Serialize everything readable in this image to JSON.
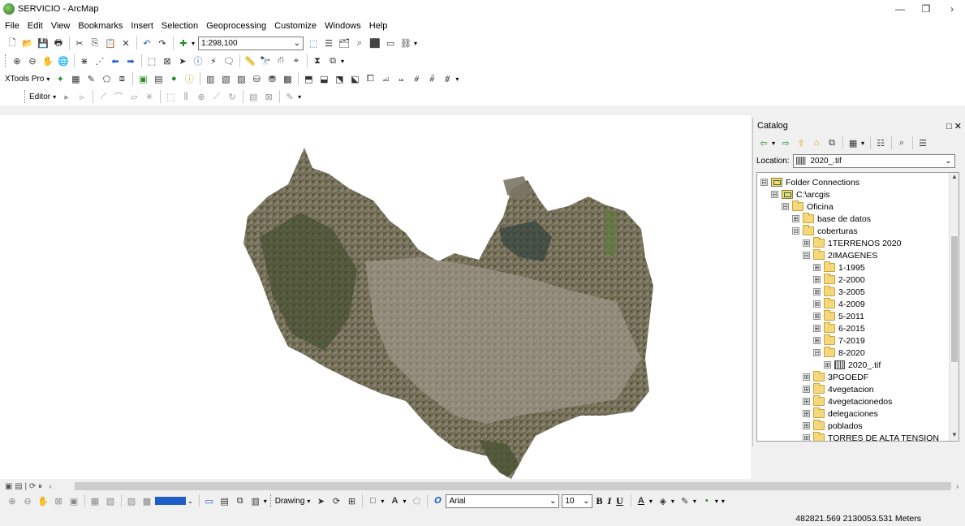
{
  "window": {
    "title": "SERVICIO - ArcMap",
    "controls": [
      "—",
      "❐",
      "›"
    ]
  },
  "menu": [
    "File",
    "Edit",
    "View",
    "Bookmarks",
    "Insert",
    "Selection",
    "Geoprocessing",
    "Customize",
    "Windows",
    "Help"
  ],
  "toolbar_standard": {
    "scale": "1:298,100"
  },
  "toolbar_xtools": {
    "label": "XTools Pro"
  },
  "toolbar_editor": {
    "label": "Editor"
  },
  "catalog": {
    "title": "Catalog",
    "location_label": "Location:",
    "location_value": "2020_.tif",
    "tree": [
      {
        "label": "Folder Connections",
        "depth": 0,
        "expander": "⊟",
        "icon": "folder-connections-icon"
      },
      {
        "label": "C:\\arcgis",
        "depth": 1,
        "expander": "⊟",
        "icon": "folder-connection-icon"
      },
      {
        "label": "Oficina",
        "depth": 2,
        "expander": "⊟",
        "icon": "folder-icon"
      },
      {
        "label": "base de datos",
        "depth": 3,
        "expander": "⊞",
        "icon": "folder-icon"
      },
      {
        "label": "coberturas",
        "depth": 3,
        "expander": "⊟",
        "icon": "folder-icon"
      },
      {
        "label": "1TERRENOS 2020",
        "depth": 4,
        "expander": "⊞",
        "icon": "folder-icon"
      },
      {
        "label": "2IMAGENES",
        "depth": 4,
        "expander": "⊟",
        "icon": "folder-icon"
      },
      {
        "label": "1-1995",
        "depth": 5,
        "expander": "⊞",
        "icon": "folder-icon"
      },
      {
        "label": "2-2000",
        "depth": 5,
        "expander": "⊞",
        "icon": "folder-icon"
      },
      {
        "label": "3-2005",
        "depth": 5,
        "expander": "⊞",
        "icon": "folder-icon"
      },
      {
        "label": "4-2009",
        "depth": 5,
        "expander": "⊞",
        "icon": "folder-icon"
      },
      {
        "label": "5-2011",
        "depth": 5,
        "expander": "⊞",
        "icon": "folder-icon"
      },
      {
        "label": "6-2015",
        "depth": 5,
        "expander": "⊞",
        "icon": "folder-icon"
      },
      {
        "label": "7-2019",
        "depth": 5,
        "expander": "⊞",
        "icon": "folder-icon"
      },
      {
        "label": "8-2020",
        "depth": 5,
        "expander": "⊟",
        "icon": "folder-icon"
      },
      {
        "label": "2020_.tif",
        "depth": 6,
        "expander": "⊞",
        "icon": "raster-icon"
      },
      {
        "label": "3PGOEDF",
        "depth": 4,
        "expander": "⊞",
        "icon": "folder-icon"
      },
      {
        "label": "4vegetacion",
        "depth": 4,
        "expander": "⊞",
        "icon": "folder-icon"
      },
      {
        "label": "4vegetacionedos",
        "depth": 4,
        "expander": "⊞",
        "icon": "folder-icon"
      },
      {
        "label": "delegaciones",
        "depth": 4,
        "expander": "⊞",
        "icon": "folder-icon"
      },
      {
        "label": "poblados",
        "depth": 4,
        "expander": "⊞",
        "icon": "folder-icon"
      },
      {
        "label": "TORRES DE ALTA TENSION",
        "depth": 4,
        "expander": "⊞",
        "icon": "folder-icon"
      }
    ]
  },
  "draw_toolbar": {
    "label": "Drawing",
    "font": "Arial",
    "size": "10",
    "bold": "B",
    "italic": "I",
    "underline": "U"
  },
  "status": {
    "coordinates": "482821.569  2130053.531 Meters"
  }
}
